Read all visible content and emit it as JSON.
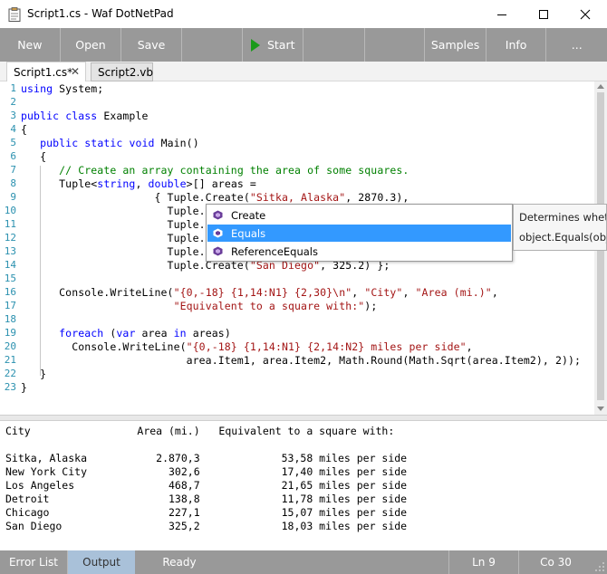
{
  "window": {
    "title": "Script1.cs - Waf DotNetPad"
  },
  "toolbar": {
    "new": "New",
    "open": "Open",
    "save": "Save",
    "start": "Start",
    "samples": "Samples",
    "info": "Info",
    "more": "..."
  },
  "tabs": [
    {
      "label": "Script1.cs*",
      "active": true
    },
    {
      "label": "Script2.vb",
      "active": false
    }
  ],
  "editor": {
    "line_numbers": [
      "1",
      "2",
      "3",
      "4",
      "5",
      "6",
      "7",
      "8",
      "9",
      "10",
      "11",
      "12",
      "13",
      "14",
      "15",
      "16",
      "17",
      "18",
      "19",
      "20",
      "21",
      "22",
      "23"
    ],
    "lines": [
      [
        {
          "t": "kw",
          "v": "using"
        },
        {
          "t": "p",
          "v": " System;"
        }
      ],
      [],
      [
        {
          "t": "kw",
          "v": "public"
        },
        {
          "t": "p",
          "v": " "
        },
        {
          "t": "kw",
          "v": "class"
        },
        {
          "t": "p",
          "v": " Example"
        }
      ],
      [
        {
          "t": "p",
          "v": "{"
        }
      ],
      [
        {
          "t": "p",
          "v": "   "
        },
        {
          "t": "kw",
          "v": "public"
        },
        {
          "t": "p",
          "v": " "
        },
        {
          "t": "kw",
          "v": "static"
        },
        {
          "t": "p",
          "v": " "
        },
        {
          "t": "kw",
          "v": "void"
        },
        {
          "t": "p",
          "v": " Main()"
        }
      ],
      [
        {
          "t": "p",
          "v": "   {"
        }
      ],
      [
        {
          "t": "p",
          "v": "      "
        },
        {
          "t": "cmt",
          "v": "// Create an array containing the area of some squares."
        }
      ],
      [
        {
          "t": "p",
          "v": "      Tuple<"
        },
        {
          "t": "kw",
          "v": "string"
        },
        {
          "t": "p",
          "v": ", "
        },
        {
          "t": "kw",
          "v": "double"
        },
        {
          "t": "p",
          "v": ">[] areas ="
        }
      ],
      [
        {
          "t": "p",
          "v": "                     { Tuple.Create("
        },
        {
          "t": "str",
          "v": "\"Sitka, Alaska\""
        },
        {
          "t": "p",
          "v": ", 2870.3),"
        }
      ],
      [
        {
          "t": "p",
          "v": "                       Tuple."
        }
      ],
      [
        {
          "t": "p",
          "v": "                       Tuple."
        }
      ],
      [
        {
          "t": "p",
          "v": "                       Tuple."
        }
      ],
      [
        {
          "t": "p",
          "v": "                       Tuple."
        }
      ],
      [
        {
          "t": "p",
          "v": "                       Tuple.Create("
        },
        {
          "t": "str",
          "v": "\"San Diego\""
        },
        {
          "t": "p",
          "v": ", 325.2) };"
        }
      ],
      [],
      [
        {
          "t": "p",
          "v": "      Console.WriteLine("
        },
        {
          "t": "str",
          "v": "\"{0,-18} {1,14:N1} {2,30}\\n\""
        },
        {
          "t": "p",
          "v": ", "
        },
        {
          "t": "str",
          "v": "\"City\""
        },
        {
          "t": "p",
          "v": ", "
        },
        {
          "t": "str",
          "v": "\"Area (mi.)\""
        },
        {
          "t": "p",
          "v": ","
        }
      ],
      [
        {
          "t": "p",
          "v": "                        "
        },
        {
          "t": "str",
          "v": "\"Equivalent to a square with:\""
        },
        {
          "t": "p",
          "v": ");"
        }
      ],
      [],
      [
        {
          "t": "p",
          "v": "      "
        },
        {
          "t": "kw",
          "v": "foreach"
        },
        {
          "t": "p",
          "v": " ("
        },
        {
          "t": "kw",
          "v": "var"
        },
        {
          "t": "p",
          "v": " area "
        },
        {
          "t": "kw",
          "v": "in"
        },
        {
          "t": "p",
          "v": " areas)"
        }
      ],
      [
        {
          "t": "p",
          "v": "        Console.WriteLine("
        },
        {
          "t": "str",
          "v": "\"{0,-18} {1,14:N1} {2,14:N2} miles per side\""
        },
        {
          "t": "p",
          "v": ","
        }
      ],
      [
        {
          "t": "p",
          "v": "                          area.Item1, area.Item2, Math.Round(Math.Sqrt(area.Item2), 2));"
        }
      ],
      [
        {
          "t": "p",
          "v": "   }"
        }
      ],
      [
        {
          "t": "p",
          "v": "}"
        }
      ]
    ]
  },
  "completion": {
    "items": [
      {
        "label": "Create",
        "selected": false
      },
      {
        "label": "Equals",
        "selected": true
      },
      {
        "label": "ReferenceEquals",
        "selected": false
      }
    ],
    "tooltip": [
      "Determines wheth",
      "object.Equals(obje"
    ]
  },
  "output": {
    "lines": [
      "City                 Area (mi.)   Equivalent to a square with:",
      "",
      "Sitka, Alaska           2.870,3             53,58 miles per side",
      "New York City             302,6             17,40 miles per side",
      "Los Angeles               468,7             21,65 miles per side",
      "Detroit                   138,8             11,78 miles per side",
      "Chicago                   227,1             15,07 miles per side",
      "San Diego                 325,2             18,03 miles per side"
    ]
  },
  "statusbar": {
    "error_list": "Error List",
    "output": "Output",
    "status": "Ready",
    "line": "Ln 9",
    "column": "Co 30"
  },
  "colors": {
    "toolbar_bg": "#999999",
    "keyword": "#0000ff",
    "string": "#a31515",
    "comment": "#008000",
    "line_number": "#2b91af",
    "selection": "#3399ff",
    "start_icon": "#1a9a1a"
  }
}
